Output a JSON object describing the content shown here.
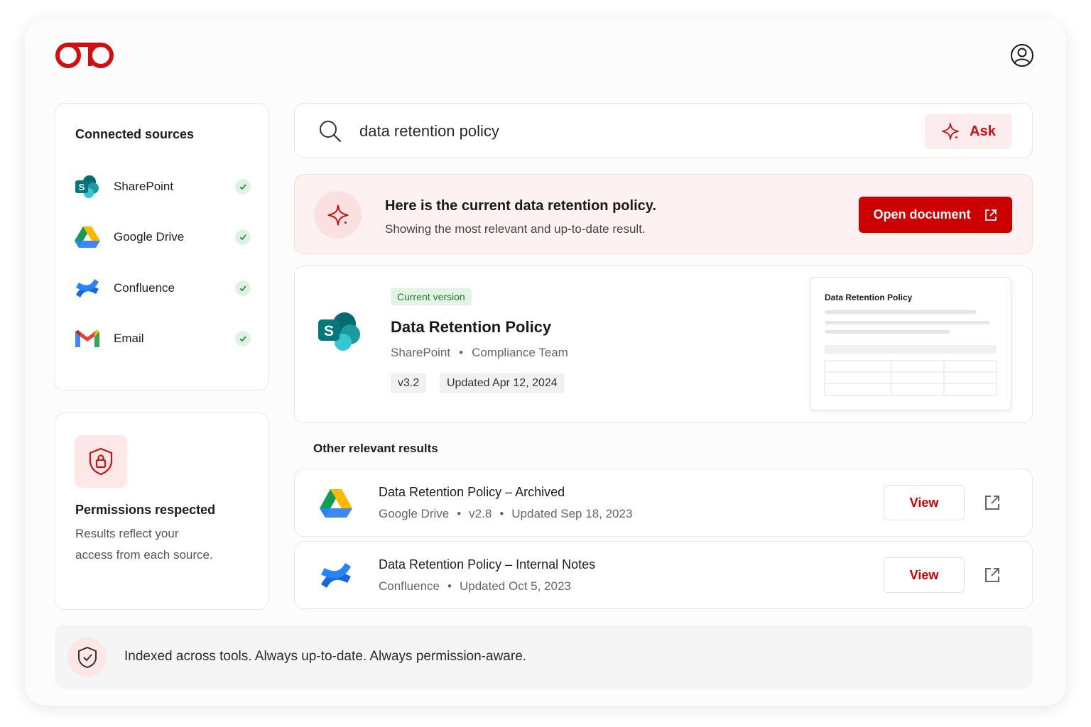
{
  "sources": {
    "heading": "Connected sources",
    "items": [
      {
        "label": "SharePoint",
        "icon": "sharepoint-icon",
        "connected": true
      },
      {
        "label": "Google Drive",
        "icon": "google-drive-icon",
        "connected": true
      },
      {
        "label": "Confluence",
        "icon": "confluence-icon",
        "connected": true
      },
      {
        "label": "Email",
        "icon": "gmail-icon",
        "connected": true
      }
    ]
  },
  "permissions": {
    "title": "Permissions respected",
    "description": "Results reflect your access from each source."
  },
  "search": {
    "query": "data retention policy",
    "ask_label": "Ask"
  },
  "answer": {
    "title": "Here is the current data retention policy.",
    "subtitle": "Showing the most relevant and up-to-date result.",
    "open_label": "Open document"
  },
  "top_result": {
    "badge": "Current version",
    "title": "Data Retention Policy",
    "source": "SharePoint",
    "team": "Compliance Team",
    "separator": "•",
    "version": "v3.2",
    "updated": "Updated Apr 12, 2024",
    "preview_title": "Data Retention Policy"
  },
  "other": {
    "heading": "Other relevant results",
    "results": [
      {
        "title": "Data Retention Policy – Archived",
        "source": "Google Drive",
        "version": "v2.8",
        "updated": "Updated Sep 18, 2023",
        "view_label": "View"
      },
      {
        "title": "Data Retention Policy – Internal Notes",
        "source": "Confluence",
        "updated": "Updated Oct 5, 2023",
        "view_label": "View"
      }
    ]
  },
  "footer": {
    "text": "Indexed across tools. Always up-to-date. Always permission-aware."
  },
  "colors": {
    "brand": "#cc0000",
    "success": "#2e8b46"
  }
}
